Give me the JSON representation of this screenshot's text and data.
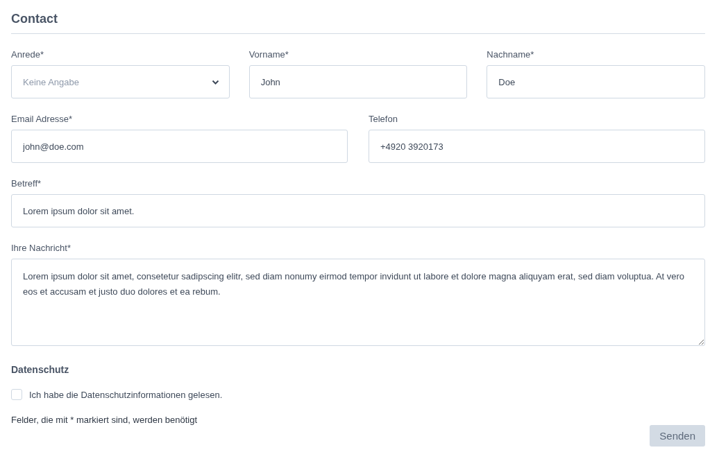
{
  "title": "Contact",
  "rows": [
    [
      {
        "kind": "select",
        "label": "Anrede*",
        "placeholder": "Keine Angabe"
      },
      {
        "kind": "input",
        "label": "Vorname*",
        "value": "John"
      },
      {
        "kind": "input",
        "label": "Nachname*",
        "value": "Doe"
      }
    ],
    [
      {
        "kind": "input",
        "label": "Email Adresse*",
        "value": "john@doe.com"
      },
      {
        "kind": "input",
        "label": "Telefon",
        "value": "+4920 3920173"
      }
    ],
    [
      {
        "kind": "input",
        "label": "Betreff*",
        "value": "Lorem ipsum dolor sit amet."
      }
    ],
    [
      {
        "kind": "textarea",
        "label": "Ihre Nachricht*",
        "value": "Lorem ipsum dolor sit amet, consetetur sadipscing elitr, sed diam nonumy eirmod tempor invidunt ut labore et dolore magna aliquyam erat, sed diam voluptua. At vero eos et accusam et justo duo dolores et ea rebum."
      }
    ]
  ],
  "privacy": {
    "heading": "Datenschutz",
    "checkbox": {
      "label": "Ich habe die Datenschutzinformationen gelesen.",
      "checked": false
    }
  },
  "note": "Felder, die mit * markiert sind, werden benötigt",
  "submit": {
    "label": "Senden",
    "disabled": true
  }
}
